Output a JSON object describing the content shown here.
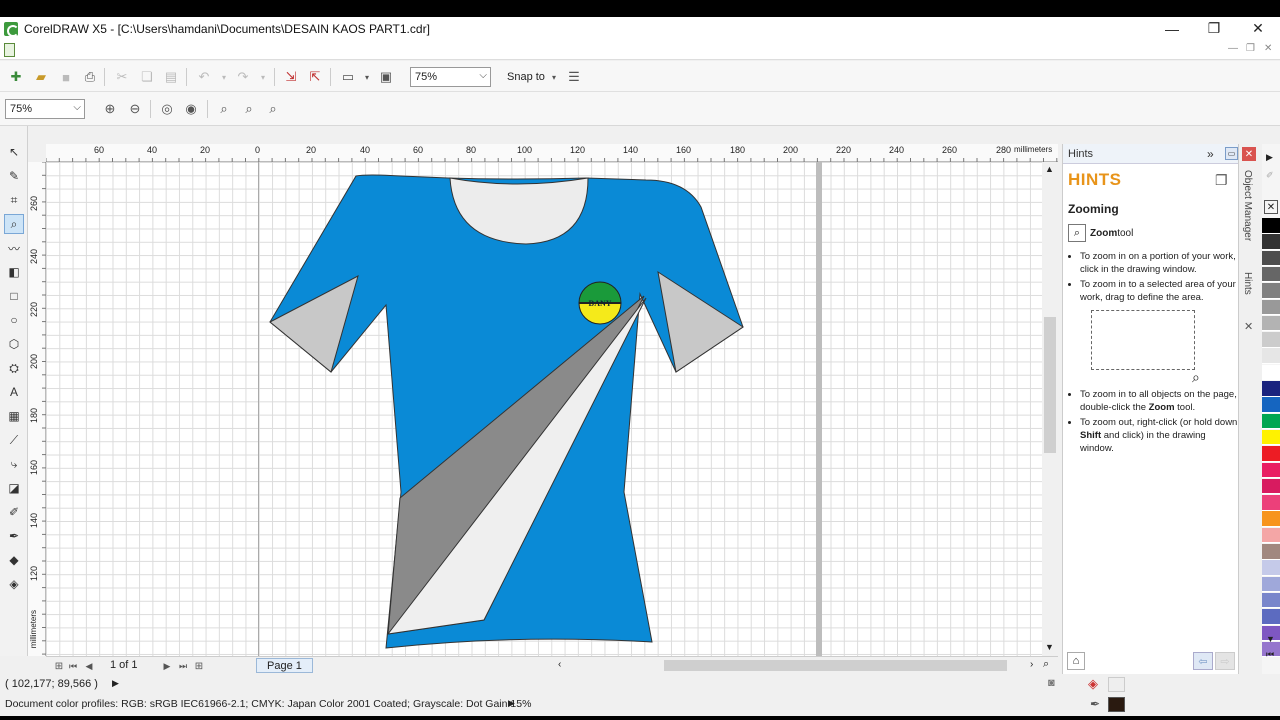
{
  "window": {
    "title": "CorelDRAW X5 - [C:\\Users\\hamdani\\Documents\\DESAIN KAOS  PART1.cdr]"
  },
  "toolbar": {
    "zoom_value": "75%",
    "snap_label": "Snap to"
  },
  "property_bar": {
    "zoom_value": "75%"
  },
  "ruler": {
    "unit": "millimeters",
    "h_ticks": [
      "60",
      "40",
      "20",
      "0",
      "20",
      "40",
      "60",
      "80",
      "100",
      "120",
      "140",
      "160",
      "180",
      "200",
      "220",
      "240",
      "260",
      "280"
    ],
    "v_ticks": [
      "260",
      "240",
      "220",
      "200",
      "180",
      "160",
      "140",
      "120"
    ]
  },
  "page_nav": {
    "position": "1 of 1",
    "page_tab": "Page 1"
  },
  "status": {
    "coords": "( 102,177; 89,566 )",
    "color_profiles": "Document color profiles: RGB: sRGB IEC61966-2.1; CMYK: Japan Color 2001 Coated; Grayscale: Dot Gain 15%"
  },
  "hints": {
    "panel_title": "Hints",
    "heading": "HINTS",
    "subheading": "Zooming",
    "tool_name": "Zoom",
    "tool_suffix": " tool",
    "bullet1": "To zoom in on a portion of your work, click in the drawing window.",
    "bullet2": "To zoom in to a selected area of your work, drag to define the area.",
    "bullet3a": "To zoom in to all objects on the page, double-click the ",
    "bullet3b": "Zoom",
    "bullet3c": " tool.",
    "bullet4a": "To zoom out, right-click (or hold down ",
    "bullet4b": "Shift",
    "bullet4c": " and click) in the drawing window."
  },
  "side_tabs": {
    "object_manager": "Object Manager",
    "hints": "Hints"
  },
  "design": {
    "logo_text": "DANY",
    "shirt_color": "#0a8ad6",
    "sleeve_color": "#c8c8c8",
    "stripe_dark": "#8a8a8a",
    "stripe_light": "#efefef",
    "logo_top": "#1a9a3a",
    "logo_bottom": "#f5ea1a"
  },
  "palette": [
    "#000000",
    "#333333",
    "#4d4d4d",
    "#666666",
    "#808080",
    "#999999",
    "#b3b3b3",
    "#cccccc",
    "#e6e6e6",
    "#ffffff",
    "#1a237e",
    "#1565c0",
    "#00a651",
    "#fff200",
    "#ed1c24",
    "#e91e63",
    "#d81b60",
    "#ec407a",
    "#f7941d",
    "#f4a6a6",
    "#a1887f",
    "#c5cae9",
    "#9fa8da",
    "#7986cb",
    "#5c6bc0",
    "#7e57c2",
    "#9575cd"
  ]
}
